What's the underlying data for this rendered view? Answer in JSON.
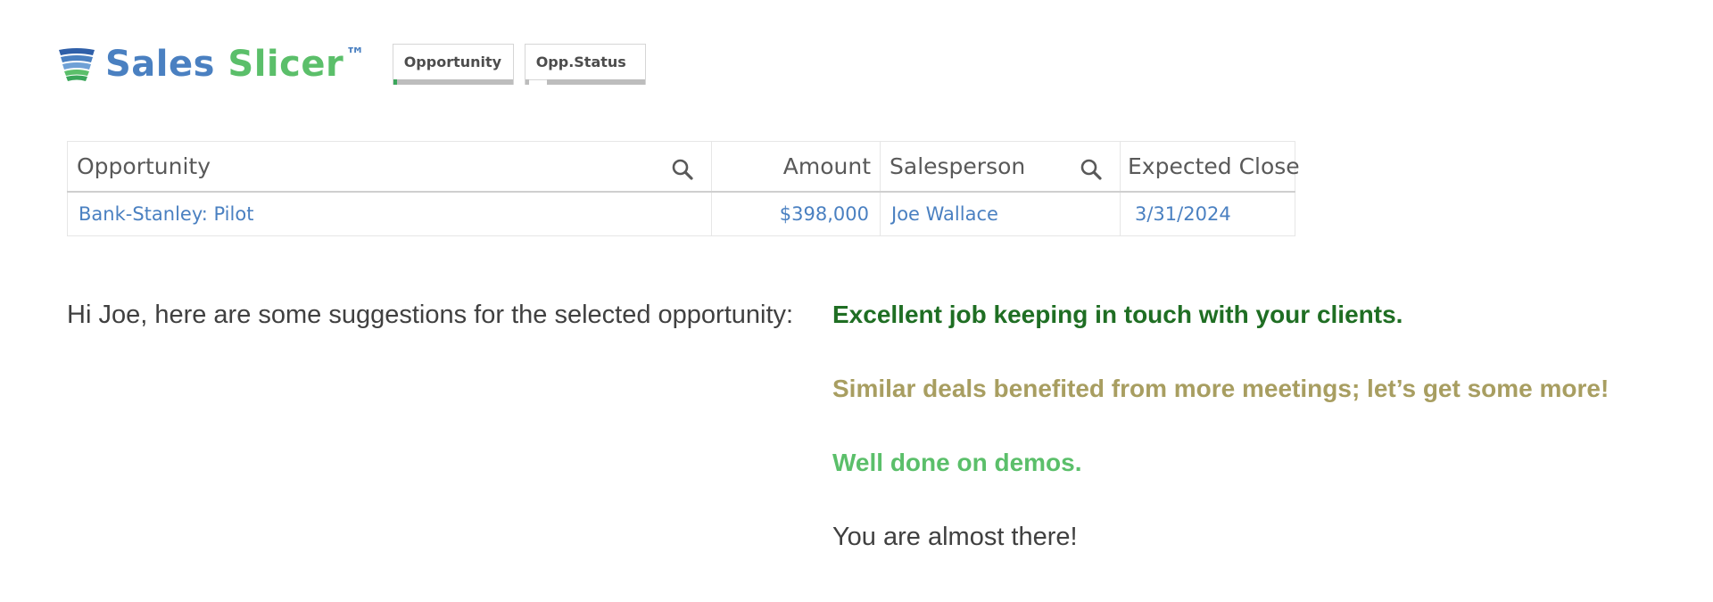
{
  "app": {
    "logo": {
      "word1": "Sales",
      "word2": "Slicer",
      "trademark": "™",
      "icon": "stacked-layers-icon",
      "colors": {
        "sales": "#4a80c1",
        "slicer": "#5bbf6a"
      }
    },
    "filters": [
      {
        "label": "Opportunity"
      },
      {
        "label": "Opp.Status"
      }
    ]
  },
  "table": {
    "columns": [
      {
        "label": "Opportunity",
        "searchable": true
      },
      {
        "label": "Amount",
        "searchable": false
      },
      {
        "label": "Salesperson",
        "searchable": true
      },
      {
        "label": "Expected Close",
        "searchable": false
      }
    ],
    "rows": [
      {
        "opportunity": "Bank-Stanley: Pilot",
        "amount": "$398,000",
        "salesperson": "Joe Wallace",
        "expected_close": "3/31/2024"
      }
    ]
  },
  "suggestions": {
    "greeting": "Hi Joe, here are some suggestions for the selected opportunity:",
    "items": [
      {
        "text": "Excellent job keeping in touch with your clients.",
        "color": "#1f6e23"
      },
      {
        "text": "Similar deals benefited from more meetings; let’s get some more!",
        "color": "#a89e61"
      },
      {
        "text": "Well done on demos.",
        "color": "#5bbf6a"
      },
      {
        "text": "You are almost there!",
        "color": "#404040"
      }
    ]
  }
}
